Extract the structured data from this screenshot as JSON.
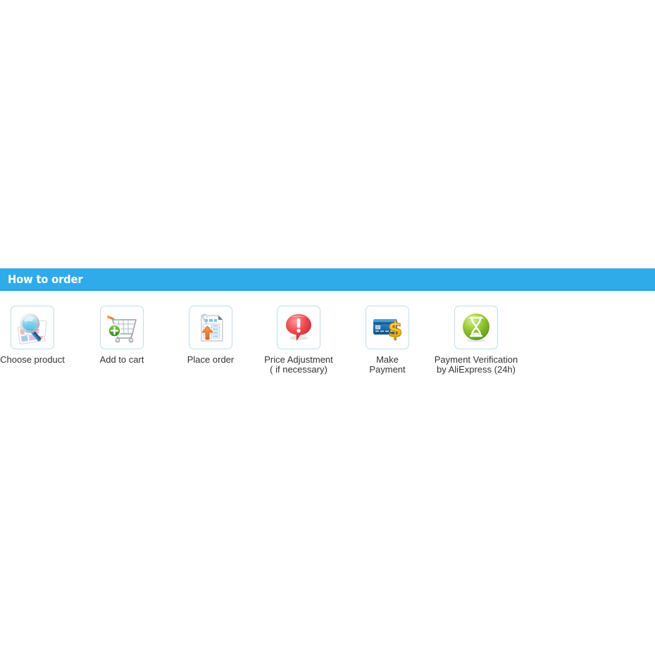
{
  "page": {
    "background": "#ffffff"
  },
  "section": {
    "title": "How to order",
    "header_bg": "#2fabe9",
    "header_text_color": "#ffffff",
    "border_color": "#bfdde8"
  },
  "steps": [
    {
      "index": 1,
      "label": "Choose product",
      "icon": "magnifier-over-photos-icon"
    },
    {
      "index": 2,
      "label": "Add to cart",
      "icon": "shopping-cart-add-icon"
    },
    {
      "index": 3,
      "label": "Place order",
      "icon": "order-form-upload-icon"
    },
    {
      "index": 4,
      "label": "Price Adjustment\n( if necessary)",
      "icon": "red-exclamation-bubble-icon"
    },
    {
      "index": 5,
      "label": "Make\nPayment",
      "icon": "credit-card-dollar-icon"
    },
    {
      "index": 6,
      "label": "Payment Verification\nby AliExpress (24h)",
      "icon": "green-hourglass-icon"
    }
  ]
}
